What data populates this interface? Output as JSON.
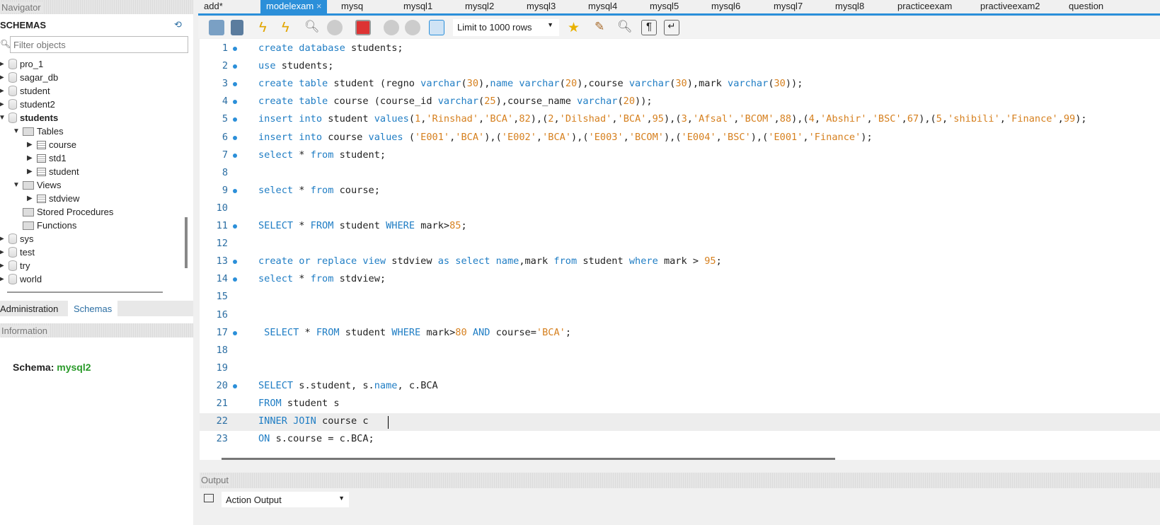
{
  "navigator": {
    "title": "Navigator",
    "schemas_label": "SCHEMAS",
    "filter_placeholder": "Filter objects",
    "tree": [
      {
        "label": "pro_1",
        "type": "db",
        "level": 0,
        "open": false
      },
      {
        "label": "sagar_db",
        "type": "db",
        "level": 0,
        "open": false
      },
      {
        "label": "student",
        "type": "db",
        "level": 0,
        "open": false
      },
      {
        "label": "student2",
        "type": "db",
        "level": 0,
        "open": false
      },
      {
        "label": "students",
        "type": "db",
        "level": 0,
        "open": true,
        "bold": true
      },
      {
        "label": "Tables",
        "type": "folder",
        "level": 1,
        "open": true
      },
      {
        "label": "course",
        "type": "table",
        "level": 2,
        "open": false
      },
      {
        "label": "std1",
        "type": "table",
        "level": 2,
        "open": false
      },
      {
        "label": "student",
        "type": "table",
        "level": 2,
        "open": false
      },
      {
        "label": "Views",
        "type": "folder",
        "level": 1,
        "open": true
      },
      {
        "label": "stdview",
        "type": "view",
        "level": 2,
        "open": false
      },
      {
        "label": "Stored Procedures",
        "type": "folder",
        "level": 1,
        "leaf": true
      },
      {
        "label": "Functions",
        "type": "folder",
        "level": 1,
        "leaf": true
      },
      {
        "label": "sys",
        "type": "db",
        "level": 0,
        "open": false
      },
      {
        "label": "test",
        "type": "db",
        "level": 0,
        "open": false
      },
      {
        "label": "try",
        "type": "db",
        "level": 0,
        "open": false
      },
      {
        "label": "world",
        "type": "db",
        "level": 0,
        "open": false
      }
    ],
    "bottom_tabs": [
      "Administration",
      "Schemas"
    ]
  },
  "information": {
    "title": "Information",
    "schema_label": "Schema:",
    "schema_value": "mysql2"
  },
  "tabs": [
    {
      "label": "add*"
    },
    {
      "label": "modelexam",
      "active": true
    },
    {
      "label": "mysq"
    },
    {
      "label": "mysql1"
    },
    {
      "label": "mysql2"
    },
    {
      "label": "mysql3"
    },
    {
      "label": "mysql4"
    },
    {
      "label": "mysql5"
    },
    {
      "label": "mysql6"
    },
    {
      "label": "mysql7"
    },
    {
      "label": "mysql8"
    },
    {
      "label": "practiceexam"
    },
    {
      "label": "practiveexam2"
    },
    {
      "label": "question"
    }
  ],
  "toolbar": {
    "limit": "Limit to 1000 rows"
  },
  "editor": {
    "lines": [
      {
        "n": "1",
        "dot": true,
        "t": [
          [
            "kw",
            "create database "
          ],
          [
            "",
            "students;"
          ]
        ]
      },
      {
        "n": "2",
        "dot": true,
        "t": [
          [
            "kw",
            "use "
          ],
          [
            "",
            "students;"
          ]
        ]
      },
      {
        "n": "3",
        "dot": true,
        "t": [
          [
            "kw",
            "create table "
          ],
          [
            "",
            "student (regno "
          ],
          [
            "kw",
            "varchar"
          ],
          [
            "",
            "("
          ],
          [
            "lit",
            "30"
          ],
          [
            "",
            "),"
          ],
          [
            "kw",
            "name varchar"
          ],
          [
            "",
            "("
          ],
          [
            "lit",
            "20"
          ],
          [
            "",
            "),course "
          ],
          [
            "kw",
            "varchar"
          ],
          [
            "",
            "("
          ],
          [
            "lit",
            "30"
          ],
          [
            "",
            "),mark "
          ],
          [
            "kw",
            "varchar"
          ],
          [
            "",
            "("
          ],
          [
            "lit",
            "30"
          ],
          [
            "",
            "));"
          ]
        ]
      },
      {
        "n": "4",
        "dot": true,
        "t": [
          [
            "kw",
            "create table "
          ],
          [
            "",
            "course (course_id "
          ],
          [
            "kw",
            "varchar"
          ],
          [
            "",
            "("
          ],
          [
            "lit",
            "25"
          ],
          [
            "",
            "),course_name "
          ],
          [
            "kw",
            "varchar"
          ],
          [
            "",
            "("
          ],
          [
            "lit",
            "20"
          ],
          [
            "",
            "));"
          ]
        ]
      },
      {
        "n": "5",
        "dot": true,
        "t": [
          [
            "kw",
            "insert into "
          ],
          [
            "",
            "student "
          ],
          [
            "kw",
            "values"
          ],
          [
            "",
            "("
          ],
          [
            "lit",
            "1"
          ],
          [
            "",
            ","
          ],
          [
            "lit",
            "'Rinshad'"
          ],
          [
            "",
            ","
          ],
          [
            "lit",
            "'BCA'"
          ],
          [
            "",
            ","
          ],
          [
            "lit",
            "82"
          ],
          [
            "",
            "),("
          ],
          [
            "lit",
            "2"
          ],
          [
            "",
            ","
          ],
          [
            "lit",
            "'Dilshad'"
          ],
          [
            "",
            ","
          ],
          [
            "lit",
            "'BCA'"
          ],
          [
            "",
            ","
          ],
          [
            "lit",
            "95"
          ],
          [
            "",
            "),("
          ],
          [
            "lit",
            "3"
          ],
          [
            "",
            ","
          ],
          [
            "lit",
            "'Afsal'"
          ],
          [
            "",
            ","
          ],
          [
            "lit",
            "'BCOM'"
          ],
          [
            "",
            ","
          ],
          [
            "lit",
            "88"
          ],
          [
            "",
            "),("
          ],
          [
            "lit",
            "4"
          ],
          [
            "",
            ","
          ],
          [
            "lit",
            "'Abshir'"
          ],
          [
            "",
            ","
          ],
          [
            "lit",
            "'BSC'"
          ],
          [
            "",
            ","
          ],
          [
            "lit",
            "67"
          ],
          [
            "",
            "),("
          ],
          [
            "lit",
            "5"
          ],
          [
            "",
            ","
          ],
          [
            "lit",
            "'shibili'"
          ],
          [
            "",
            ","
          ],
          [
            "lit",
            "'Finance'"
          ],
          [
            "",
            ","
          ],
          [
            "lit",
            "99"
          ],
          [
            "",
            ");"
          ]
        ]
      },
      {
        "n": "6",
        "dot": true,
        "t": [
          [
            "kw",
            "insert into "
          ],
          [
            "",
            "course "
          ],
          [
            "kw",
            "values "
          ],
          [
            "",
            "("
          ],
          [
            "lit",
            "'E001'"
          ],
          [
            "",
            ","
          ],
          [
            "lit",
            "'BCA'"
          ],
          [
            "",
            "),("
          ],
          [
            "lit",
            "'E002'"
          ],
          [
            "",
            ","
          ],
          [
            "lit",
            "'BCA'"
          ],
          [
            "",
            "),("
          ],
          [
            "lit",
            "'E003'"
          ],
          [
            "",
            ","
          ],
          [
            "lit",
            "'BCOM'"
          ],
          [
            "",
            "),("
          ],
          [
            "lit",
            "'E004'"
          ],
          [
            "",
            ","
          ],
          [
            "lit",
            "'BSC'"
          ],
          [
            "",
            "),("
          ],
          [
            "lit",
            "'E001'"
          ],
          [
            "",
            ","
          ],
          [
            "lit",
            "'Finance'"
          ],
          [
            "",
            ");"
          ]
        ]
      },
      {
        "n": "7",
        "dot": true,
        "t": [
          [
            "kw",
            "select "
          ],
          [
            "",
            "* "
          ],
          [
            "kw",
            "from "
          ],
          [
            "",
            "student;"
          ]
        ]
      },
      {
        "n": "8",
        "dot": false,
        "t": []
      },
      {
        "n": "9",
        "dot": true,
        "t": [
          [
            "kw",
            "select "
          ],
          [
            "",
            "* "
          ],
          [
            "kw",
            "from "
          ],
          [
            "",
            "course;"
          ]
        ]
      },
      {
        "n": "10",
        "dot": false,
        "t": []
      },
      {
        "n": "11",
        "dot": true,
        "t": [
          [
            "kw",
            "SELECT "
          ],
          [
            "",
            "* "
          ],
          [
            "kw",
            "FROM "
          ],
          [
            "",
            "student "
          ],
          [
            "kw",
            "WHERE "
          ],
          [
            "",
            "mark>"
          ],
          [
            "lit",
            "85"
          ],
          [
            "",
            ";"
          ]
        ]
      },
      {
        "n": "12",
        "dot": false,
        "t": []
      },
      {
        "n": "13",
        "dot": true,
        "t": [
          [
            "kw",
            "create or replace view "
          ],
          [
            "",
            "stdview "
          ],
          [
            "kw",
            "as select name"
          ],
          [
            "",
            ",mark "
          ],
          [
            "kw",
            "from "
          ],
          [
            "",
            "student "
          ],
          [
            "kw",
            "where "
          ],
          [
            "",
            "mark > "
          ],
          [
            "lit",
            "95"
          ],
          [
            "",
            ";"
          ]
        ]
      },
      {
        "n": "14",
        "dot": true,
        "t": [
          [
            "kw",
            "select "
          ],
          [
            "",
            "* "
          ],
          [
            "kw",
            "from "
          ],
          [
            "",
            "stdview;"
          ]
        ]
      },
      {
        "n": "15",
        "dot": false,
        "t": []
      },
      {
        "n": "16",
        "dot": false,
        "t": []
      },
      {
        "n": "17",
        "dot": true,
        "t": [
          [
            "kw",
            " SELECT "
          ],
          [
            "",
            "* "
          ],
          [
            "kw",
            "FROM "
          ],
          [
            "",
            "student "
          ],
          [
            "kw",
            "WHERE "
          ],
          [
            "",
            "mark>"
          ],
          [
            "lit",
            "80"
          ],
          [
            "kw",
            " AND "
          ],
          [
            "",
            "course="
          ],
          [
            "lit",
            "'BCA'"
          ],
          [
            "",
            ";"
          ]
        ]
      },
      {
        "n": "18",
        "dot": false,
        "t": []
      },
      {
        "n": "19",
        "dot": false,
        "t": []
      },
      {
        "n": "20",
        "dot": true,
        "t": [
          [
            "kw",
            "SELECT "
          ],
          [
            "",
            "s.student, s."
          ],
          [
            "kw",
            "name"
          ],
          [
            "",
            ", c.BCA"
          ]
        ]
      },
      {
        "n": "21",
        "dot": false,
        "t": [
          [
            "kw",
            "FROM "
          ],
          [
            "",
            "student s"
          ]
        ]
      },
      {
        "n": "22",
        "dot": false,
        "t": [
          [
            "kw",
            "INNER JOIN "
          ],
          [
            "",
            "course c"
          ]
        ]
      },
      {
        "n": "23",
        "dot": false,
        "t": [
          [
            "kw",
            "ON "
          ],
          [
            "",
            "s.course = c.BCA;"
          ]
        ]
      }
    ]
  },
  "output": {
    "title": "Output",
    "selector": "Action Output"
  }
}
